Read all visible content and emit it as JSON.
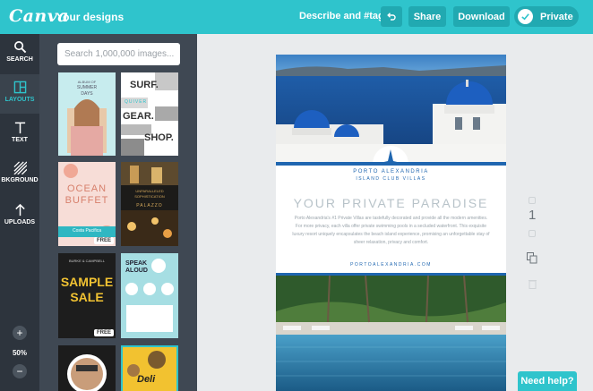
{
  "app": {
    "logo": "Canva",
    "your_designs": "Your designs",
    "describe": "Describe and #tag"
  },
  "toolbar": {
    "share": "Share",
    "download": "Download",
    "private": "Private"
  },
  "rail": {
    "items": [
      {
        "label": "SEARCH",
        "icon": "search-icon"
      },
      {
        "label": "LAYOUTS",
        "icon": "layouts-icon"
      },
      {
        "label": "TEXT",
        "icon": "text-icon"
      },
      {
        "label": "BKGROUND",
        "icon": "background-icon"
      },
      {
        "label": "UPLOADS",
        "icon": "upload-icon"
      }
    ],
    "zoom_plus": "+",
    "zoom": "50%",
    "zoom_minus": "−"
  },
  "panel": {
    "search_placeholder": "Search 1,000,000 images...",
    "thumbs": [
      {
        "lines": [
          "ALBUM OF",
          "SUMMER",
          "DAYS"
        ]
      },
      {
        "lines": [
          "SURF.",
          "QUIVER",
          "GEAR.",
          "SHOP."
        ]
      },
      {
        "lines": [
          "OCEAN",
          "BUFFET",
          "Costa Pacifica"
        ],
        "badge": "FREE"
      },
      {
        "lines": [
          "UNPARALLELED",
          "SOPHISTICATION",
          "PALAZZO"
        ]
      },
      {
        "lines": [
          "BURKE & CAMPBELL",
          "SAMPLE",
          "SALE"
        ],
        "badge": "FREE"
      },
      {
        "lines": [
          "SPEAK",
          "ALOUD"
        ]
      },
      {
        "lines": []
      },
      {
        "lines": [
          "Deli"
        ]
      }
    ]
  },
  "design": {
    "brand": "PORTO ALEXANDRIA",
    "brand_sub": "ISLAND CLUB VILLAS",
    "headline": "YOUR PRIVATE PARADISE",
    "body": "Porto Alexandria's #1 Private Villas are tastefully decorated and provide all the modern amenities. For more privacy, each villa offer private swimming pools in a secluded waterfront. This exquisite luxury resort uniquely encapsulates the beach island experience, promising an unforgettable stay of sheer relaxation, privacy and comfort.",
    "url": "PORTOALEXANDRIA.COM"
  },
  "page_number": "1",
  "help": "Need help?",
  "colors": {
    "accent": "#2fc4cc",
    "rail": "#2d343d",
    "panel": "#3f4853",
    "brand_blue": "#1f66b0"
  }
}
